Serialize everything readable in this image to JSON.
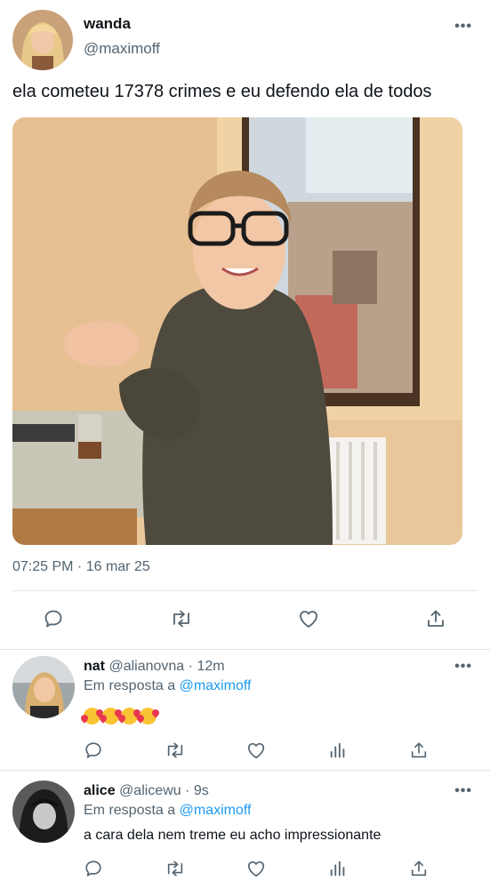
{
  "main_tweet": {
    "author_name": "wanda",
    "author_handle": "@maximoff",
    "text": "ela cometeu 17378 crimes e eu defendo ela de todos",
    "timestamp": "07:25 PM · 16 mar 25",
    "more_icon": "more-icon",
    "actions": [
      "reply-icon",
      "retweet-icon",
      "like-icon",
      "share-icon"
    ]
  },
  "replies": [
    {
      "name": "nat",
      "handle": "@alianovna",
      "time": "12m",
      "reply_prefix": "Em resposta a",
      "reply_to": "@maximoff",
      "emoji_text": "🥰🥰🥰🥰",
      "actions": [
        "reply-icon",
        "retweet-icon",
        "like-icon",
        "analytics-icon",
        "share-icon"
      ]
    },
    {
      "name": "alice",
      "handle": "@alicewu",
      "time": "9s",
      "reply_prefix": "Em resposta a",
      "reply_to": "@maximoff",
      "text": "a cara dela nem treme eu acho impressionante",
      "actions": [
        "reply-icon",
        "retweet-icon",
        "like-icon",
        "analytics-icon",
        "share-icon"
      ]
    }
  ],
  "colors": {
    "text": "#0f1419",
    "secondary": "#536471",
    "link": "#1d9bf0",
    "divider": "#e1e6ea"
  }
}
